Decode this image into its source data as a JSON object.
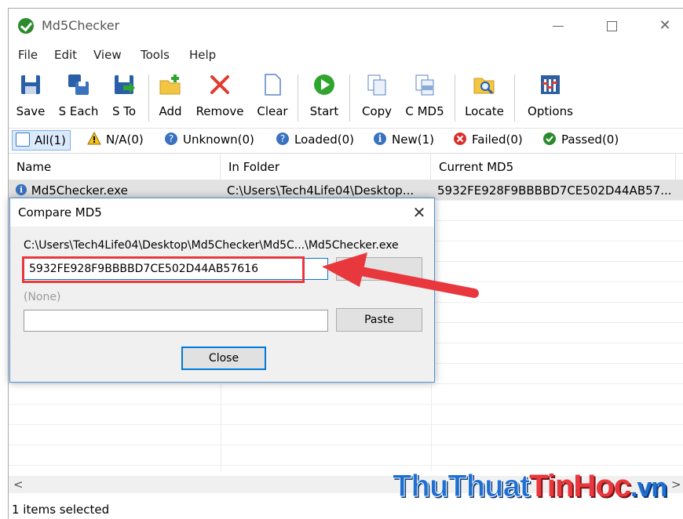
{
  "window": {
    "title": "Md5Checker"
  },
  "menu": [
    "File",
    "Edit",
    "View",
    "Tools",
    "Help"
  ],
  "toolbar": {
    "save": "Save",
    "s_each": "S Each",
    "s_to": "S To",
    "add": "Add",
    "remove": "Remove",
    "clear": "Clear",
    "start": "Start",
    "copy": "Copy",
    "c_md5": "C MD5",
    "locate": "Locate",
    "options": "Options"
  },
  "filters": {
    "all": "All(1)",
    "na": "N/A(0)",
    "unknown": "Unknown(0)",
    "loaded": "Loaded(0)",
    "new": "New(1)",
    "failed": "Failed(0)",
    "passed": "Passed(0)"
  },
  "list": {
    "columns": [
      "Name",
      "In Folder",
      "Current MD5"
    ],
    "rows": [
      {
        "name": "Md5Checker.exe",
        "folder": "C:\\Users\\Tech4Life04\\Desktop...",
        "md5": "5932FE928F9BBBBD7CE502D44AB57..."
      }
    ]
  },
  "status": {
    "text": "1 items selected"
  },
  "dialog": {
    "title": "Compare MD5",
    "path": "C:\\Users\\Tech4Life04\\Desktop\\Md5Checker\\Md5C...\\Md5Checker.exe",
    "md5_value": "5932FE928F9BBBBD7CE502D44AB57616",
    "compare_label": "(None)",
    "compare_value": "",
    "paste": "Paste",
    "close": "Close"
  },
  "watermark": {
    "part1": "ThuThuat",
    "part2": "TinHoc",
    "part3": ".vn"
  },
  "colors": {
    "accent": "#0078d7",
    "annotation": "#e8383d"
  }
}
